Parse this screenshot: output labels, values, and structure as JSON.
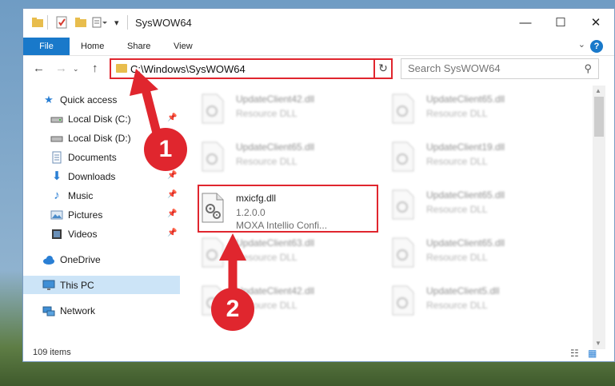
{
  "window": {
    "title": "SysWOW64"
  },
  "ribbon": {
    "tabs": [
      "File",
      "Home",
      "Share",
      "View"
    ],
    "help": "?"
  },
  "nav": {
    "back": "←",
    "forward": "→",
    "up": "↑"
  },
  "address": {
    "path": "C:\\Windows\\SysWOW64",
    "dropdown": "⌄",
    "refresh": "↻"
  },
  "search": {
    "placeholder": "Search SysWOW64"
  },
  "sidebar": {
    "items": [
      {
        "label": "Quick access",
        "icon": "star-icon",
        "pinned": false
      },
      {
        "label": "Local Disk (C:)",
        "icon": "drive-icon",
        "pinned": true
      },
      {
        "label": "Local Disk (D:)",
        "icon": "drive-icon",
        "pinned": true
      },
      {
        "label": "Documents",
        "icon": "document-icon",
        "pinned": true
      },
      {
        "label": "Downloads",
        "icon": "download-icon",
        "pinned": true
      },
      {
        "label": "Music",
        "icon": "music-icon",
        "pinned": true
      },
      {
        "label": "Pictures",
        "icon": "picture-icon",
        "pinned": true
      },
      {
        "label": "Videos",
        "icon": "video-icon",
        "pinned": true
      },
      {
        "label": "OneDrive",
        "icon": "cloud-icon",
        "pinned": false
      },
      {
        "label": "This PC",
        "icon": "monitor-icon",
        "pinned": false,
        "selected": true
      },
      {
        "label": "Network",
        "icon": "network-icon",
        "pinned": false
      }
    ]
  },
  "files": {
    "left": [
      {
        "name": "UpdateClient42.dll",
        "type": "Resource DLL",
        "blurred": true
      },
      {
        "name": "UpdateClient65.dll",
        "type": "Resource DLL",
        "blurred": true
      },
      {
        "name": "mxicfg.dll",
        "version": "1.2.0.0",
        "type": "MOXA Intellio Confi...",
        "blurred": false
      },
      {
        "name": "UpdateClient63.dll",
        "type": "Resource DLL",
        "blurred": true
      },
      {
        "name": "UpdateClient42.dll",
        "type": "Resource DLL",
        "blurred": true
      }
    ],
    "right": [
      {
        "name": "UpdateClient65.dll",
        "type": "Resource DLL",
        "blurred": true
      },
      {
        "name": "UpdateClient19.dll",
        "type": "Resource DLL",
        "blurred": true
      },
      {
        "name": "UpdateClient65.dll",
        "type": "Resource DLL",
        "blurred": true
      },
      {
        "name": "UpdateClient65.dll",
        "type": "Resource DLL",
        "blurred": true
      },
      {
        "name": "UpdateClient5.dll",
        "type": "Resource DLL",
        "blurred": true
      }
    ]
  },
  "status": {
    "count": "109 items"
  },
  "annotations": [
    "1",
    "2"
  ],
  "colors": {
    "accent": "#1979ca",
    "highlight": "#e0262e",
    "selected": "#cce4f7"
  }
}
